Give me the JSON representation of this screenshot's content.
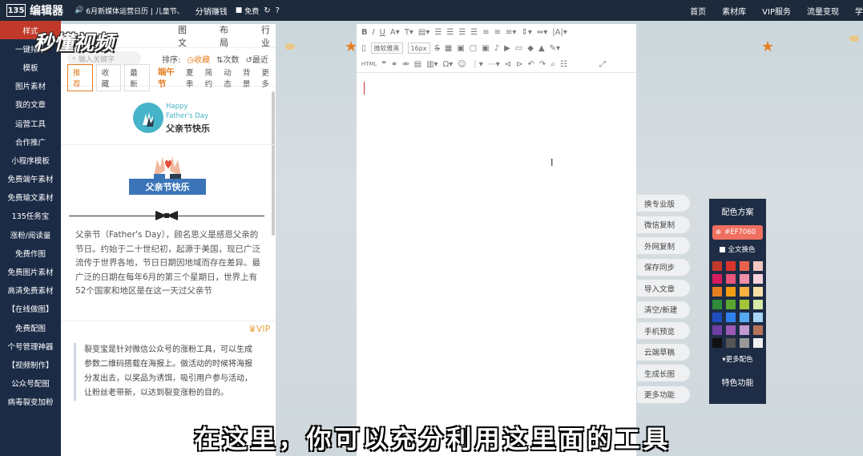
{
  "topbar": {
    "logo_mark": "135",
    "app_name": "编辑器",
    "notice": "6月新媒体运营日历 | 儿童节、",
    "distribution": "分销赚钱",
    "free_label": "免费",
    "nav": [
      "首页",
      "素材库",
      "VIP服务",
      "流量变现",
      "学"
    ]
  },
  "sidebar": {
    "items": [
      "样式",
      "一键排版",
      "模板",
      "图片素材",
      "我的文章",
      "运营工具",
      "合作推广",
      "小程序模板",
      "免费端午素材",
      "免费瑜文素材",
      "135任务宝",
      "涨粉/阅读量",
      "免费作图",
      "免费图片素材",
      "高清免费素材",
      "【在线做图】",
      "免费配图",
      "个号管理神器",
      "【视频制作】",
      "公众号配图",
      "病毒裂变加粉"
    ]
  },
  "panel": {
    "tabs": [
      "图文",
      "布局",
      "行业"
    ],
    "search_placeholder": "输入关键字",
    "sort_label": "排序:",
    "sort_options": [
      "收藏",
      "次数",
      "最近"
    ],
    "filters": [
      "推荐",
      "收藏",
      "最新"
    ],
    "tags": [
      "端午节",
      "夏季",
      "简约",
      "动态",
      "背景",
      "更多"
    ],
    "card1": {
      "en_line1": "Happy",
      "en_line2": "Father's Day",
      "cn_title": "父亲节快乐"
    },
    "card2": {
      "ribbon": "父亲节快乐",
      "text": "父亲节（Father's Day），顾名思义是感恩父亲的节日。约始于二十世纪初，起源于美国，现已广泛流传于世界各地，节日日期因地域而存在差异。最广泛的日期在每年6月的第三个星期日，世界上有52个国家和地区是在这一天过父亲节"
    },
    "vip_label": "VIP",
    "card3_text": "裂变宝是针对微信公众号的涨粉工具，可以生成参数二维码搭载在海报上。做活动的时候将海报分发出去，以奖品为诱饵，吸引用户参与活动，让粉丝老带新，以达到裂变涨粉的目的。"
  },
  "editor": {
    "font_name": "微软雅黑",
    "font_size": "16px"
  },
  "tools": [
    "换专业版",
    "微信复制",
    "外网复制",
    "保存同步",
    "导入文章",
    "清空/新建",
    "手机预览",
    "云端草稿",
    "生成长图",
    "更多功能"
  ],
  "color_panel": {
    "title": "配色方案",
    "current": "#EF7060",
    "all_label": "全文换色",
    "more_label": "更多配色",
    "feature_label": "特色功能",
    "swatches": [
      "#c0392b",
      "#d9342b",
      "#e8624f",
      "#f2c6c0",
      "#d81b60",
      "#e8547a",
      "#f08fa8",
      "#f7d3dd",
      "#e67e22",
      "#f39c12",
      "#f5b041",
      "#f9e0a8",
      "#2e8b3a",
      "#5aa62f",
      "#a4c639",
      "#d7e8a8",
      "#1f4fbf",
      "#2f80ed",
      "#56a8f0",
      "#a8d4f7",
      "#6f3fa6",
      "#9b59b6",
      "#c39bd3",
      "#b5735a",
      "#111111",
      "#555555",
      "#999999",
      "#f0f0f0"
    ]
  },
  "overlay": {
    "watermark": "秒懂视频",
    "subtitle": "在这里，你可以充分利用这里面的工具"
  }
}
